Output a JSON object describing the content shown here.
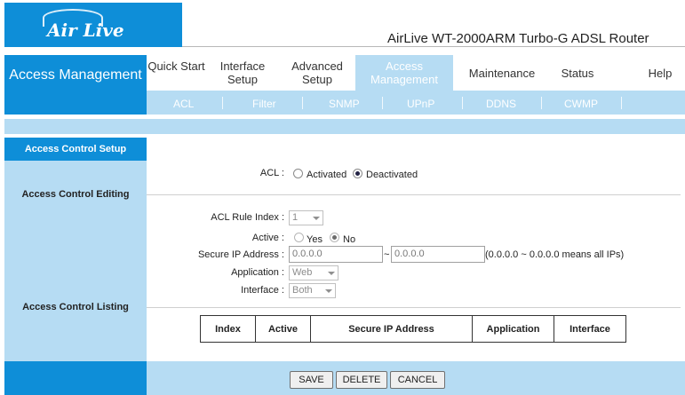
{
  "header": {
    "logo_text": "Air Live",
    "router_title": "AirLive WT-2000ARM Turbo-G ADSL Router"
  },
  "nav": {
    "section_title": "Access Management",
    "items": [
      {
        "label": "Quick Start"
      },
      {
        "label": "Interface Setup"
      },
      {
        "label": "Advanced Setup"
      },
      {
        "label": "Access Management"
      },
      {
        "label": "Maintenance"
      },
      {
        "label": "Status"
      },
      {
        "label": "Help"
      }
    ],
    "sub_items": [
      {
        "label": "ACL"
      },
      {
        "label": "Filter"
      },
      {
        "label": "SNMP"
      },
      {
        "label": "UPnP"
      },
      {
        "label": "DDNS"
      },
      {
        "label": "CWMP"
      }
    ]
  },
  "sidebar": {
    "setup": "Access Control Setup",
    "editing": "Access Control Editing",
    "listing": "Access Control Listing"
  },
  "form": {
    "acl_label": "ACL :",
    "acl_activated": "Activated",
    "acl_deactivated": "Deactivated",
    "acl_selected": "Deactivated",
    "rule_index_label": "ACL Rule Index :",
    "rule_index_value": "1",
    "active_label": "Active :",
    "active_yes": "Yes",
    "active_no": "No",
    "active_selected": "No",
    "secure_ip_label": "Secure IP Address :",
    "ip_start": "0.0.0.0",
    "ip_separator": "~",
    "ip_end": "0.0.0.0",
    "ip_hint": "(0.0.0.0 ~ 0.0.0.0 means all IPs)",
    "application_label": "Application :",
    "application_value": "Web",
    "interface_label": "Interface :",
    "interface_value": "Both"
  },
  "table": {
    "headers": [
      "Index",
      "Active",
      "Secure IP Address",
      "Application",
      "Interface"
    ]
  },
  "buttons": {
    "save": "SAVE",
    "delete": "DELETE",
    "cancel": "CANCEL"
  },
  "colors": {
    "brand_blue": "#0e8ed8",
    "light_blue": "#b6dcf3"
  }
}
